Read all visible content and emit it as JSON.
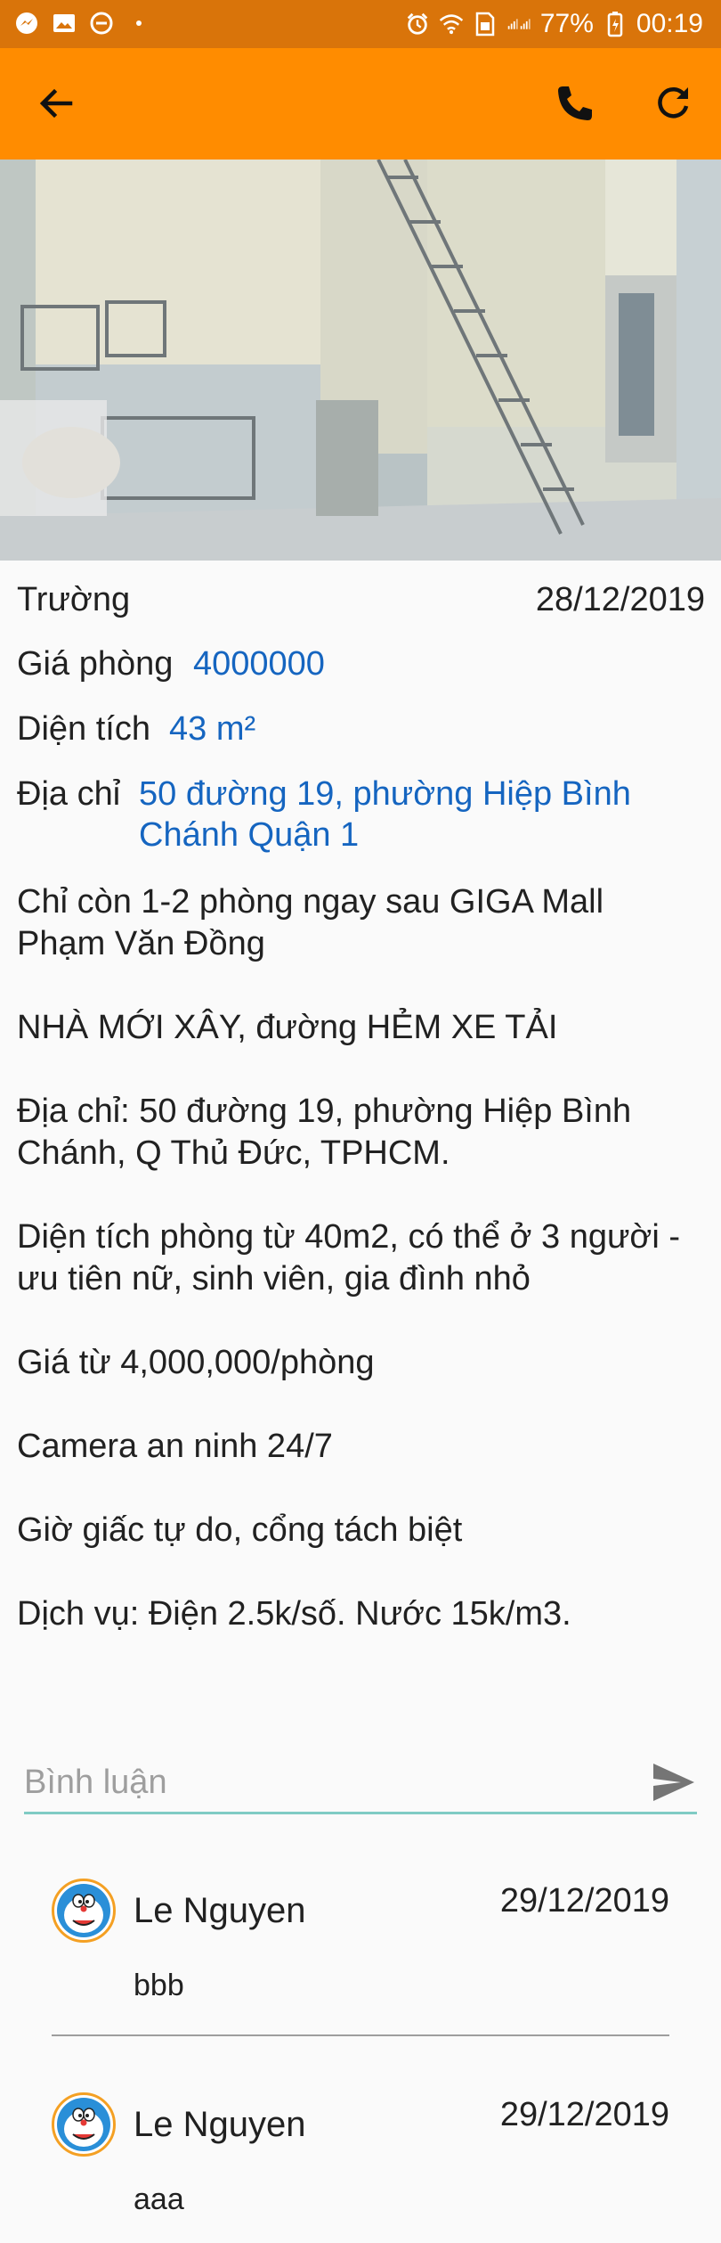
{
  "status_bar": {
    "battery": "77%",
    "time": "00:19",
    "left_icons": [
      "messenger-icon",
      "gallery-icon",
      "dnd-icon",
      "dot-icon"
    ],
    "right_icons": [
      "alarm-icon",
      "wifi-icon",
      "sim-icon",
      "signal-icon",
      "battery-icon"
    ]
  },
  "app_bar": {
    "icons": [
      "back-arrow-icon",
      "phone-icon",
      "refresh-icon"
    ],
    "color": "#ff8c00"
  },
  "listing": {
    "owner": "Trường",
    "date": "28/12/2019",
    "price_label": "Giá phòng",
    "price_value": "4000000",
    "area_label": "Diện tích",
    "area_value": "43 m²",
    "address_label": "Địa chỉ",
    "address_line1": "50 đường 19, phường Hiệp Bình",
    "address_line2": "Chánh Quận 1",
    "description_lines": [
      "Chỉ còn 1-2 phòng ngay sau GIGA Mall",
      "Phạm Văn Đồng",
      "NHÀ MỚI XÂY, đường HẺM XE TẢI",
      "Địa chỉ: 50 đường 19, phường Hiệp Bình",
      "Chánh, Q Thủ Đức, TPHCM.",
      "Diện tích phòng từ 40m2, có thể ở 3 người -",
      "ưu tiên nữ, sinh viên, gia đình nhỏ",
      "Giá từ 4,000,000/phòng",
      "Camera an ninh 24/7",
      "Giờ giấc tự do, cổng tách biệt",
      "Dịch vụ: Điện 2.5k/số. Nước 15k/m3."
    ],
    "accent_color": "#1565c0"
  },
  "comment_input": {
    "placeholder": "Bình luận",
    "value": ""
  },
  "comments": [
    {
      "name": "Le Nguyen",
      "date": "29/12/2019",
      "text": "bbb"
    },
    {
      "name": "Le Nguyen",
      "date": "29/12/2019",
      "text": "aaa"
    }
  ]
}
